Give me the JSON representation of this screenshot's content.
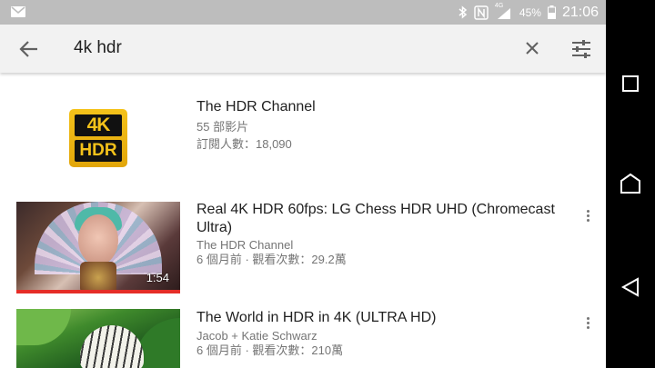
{
  "status_bar": {
    "network_label": "4G",
    "battery": "45%",
    "time": "21:06",
    "icons": [
      "mail-icon",
      "bluetooth-icon",
      "nfc-icon",
      "signal-icon",
      "battery-icon"
    ]
  },
  "search": {
    "query": "4k hdr",
    "icons": [
      "back-arrow-icon",
      "clear-icon",
      "filter-icon"
    ]
  },
  "results": [
    {
      "type": "channel",
      "title": "The HDR Channel",
      "video_count": "55 部影片",
      "subscribers": "訂閱人數：18,090",
      "logo_top": "4K",
      "logo_bottom": "HDR"
    },
    {
      "type": "video",
      "title": "Real 4K HDR 60fps: LG Chess HDR UHD (Chromecast Ultra)",
      "channel": "The HDR Channel",
      "stats": "6 個月前 · 觀看次數：29.2萬",
      "duration": "1:54",
      "watched_progress": 1.0
    },
    {
      "type": "video",
      "title": "The World in HDR in 4K (ULTRA HD)",
      "channel": "Jacob + Katie Schwarz",
      "stats": "6 個月前 · 觀看次數：210萬"
    }
  ],
  "nav_bar": {
    "icons": [
      "recents-icon",
      "home-icon",
      "back-icon"
    ]
  },
  "colors": {
    "status_bar": "#bdbdbd",
    "search_bar": "#f2f2f2",
    "progress": "#e52d27",
    "logo_gold": "#f4c21a"
  }
}
